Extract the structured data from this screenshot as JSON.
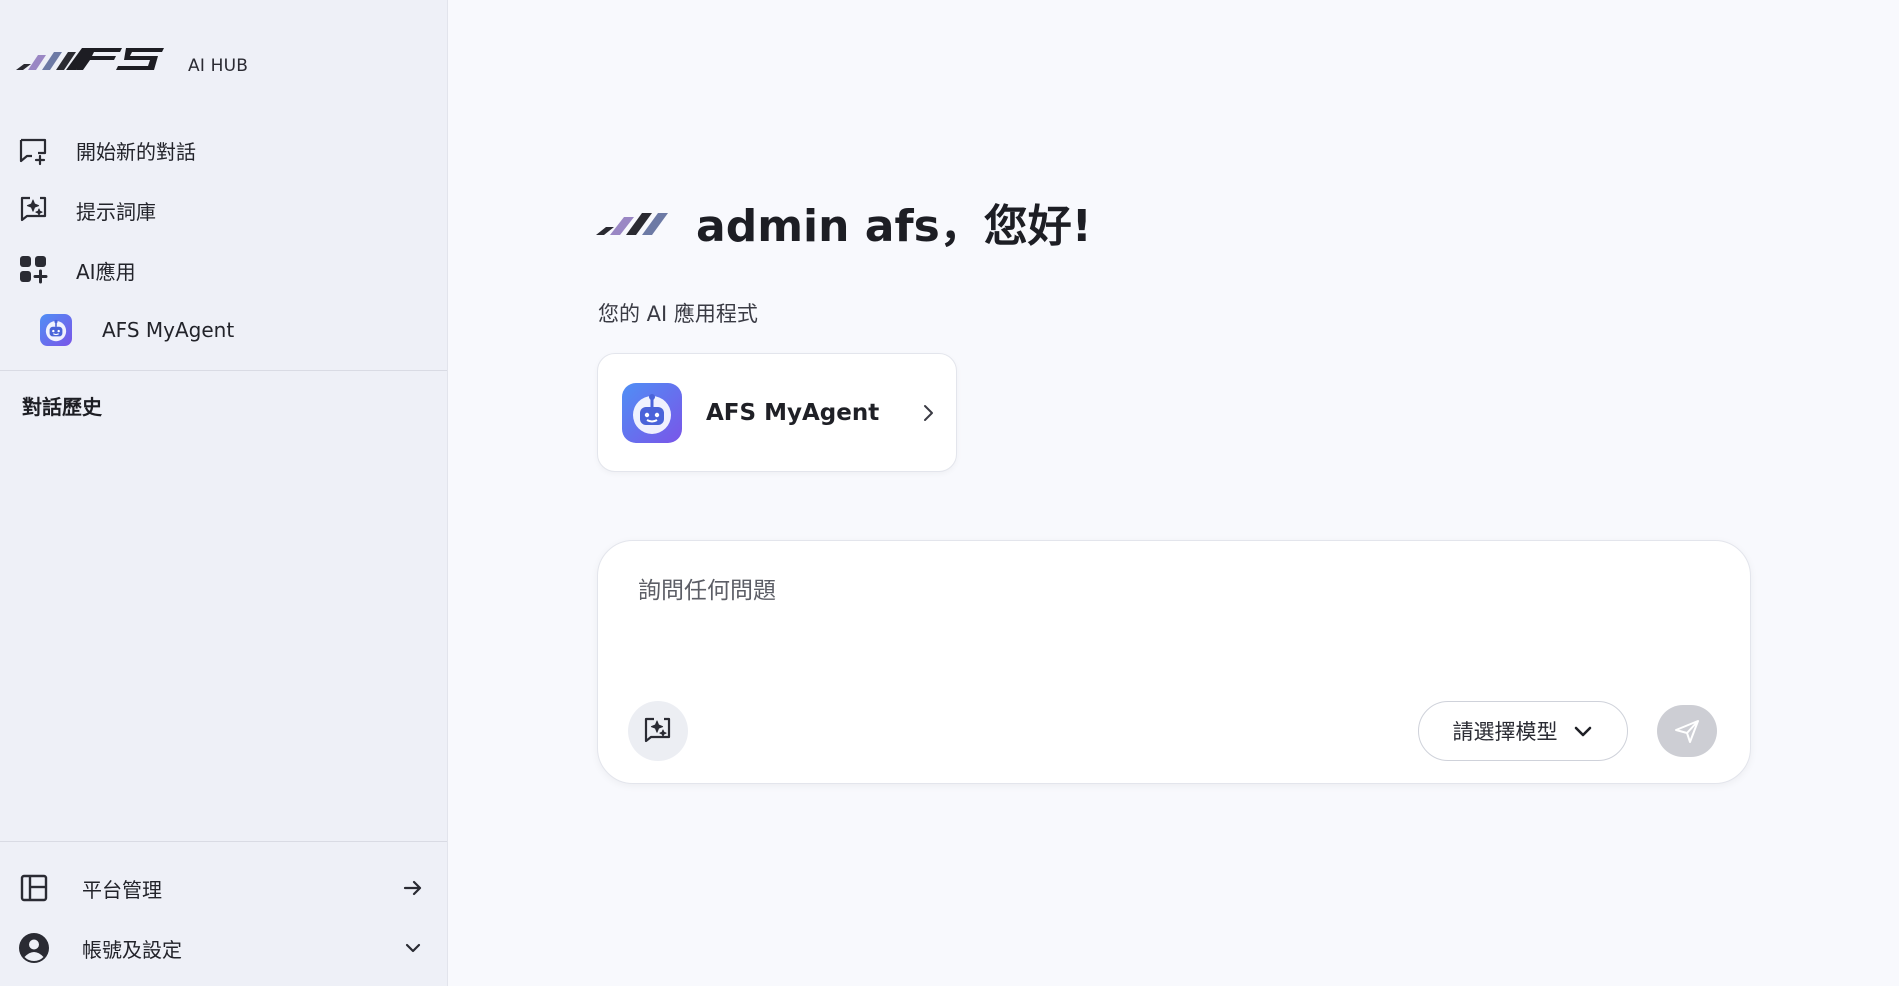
{
  "brand": {
    "logo_text": "AFS",
    "sub": "AI HUB"
  },
  "sidebar": {
    "items": [
      {
        "label": "開始新的對話",
        "icon": "new-chat-icon"
      },
      {
        "label": "提示詞庫",
        "icon": "prompt-library-icon"
      },
      {
        "label": "AI應用",
        "icon": "apps-grid-icon"
      },
      {
        "label": "AFS MyAgent",
        "icon": "robot-icon"
      }
    ],
    "history_title": "對話歷史",
    "bottom": [
      {
        "label": "平台管理",
        "icon": "layout-panel-icon",
        "trail": "arrow-right-icon"
      },
      {
        "label": "帳號及設定",
        "icon": "account-circle-icon",
        "trail": "chevron-down-icon"
      }
    ]
  },
  "main": {
    "greeting": "admin afs，您好!",
    "apps_label": "您的 AI 應用程式",
    "app_card": {
      "name": "AFS MyAgent"
    },
    "composer": {
      "placeholder": "詢問任何問題",
      "model_select_label": "請選擇模型"
    }
  },
  "colors": {
    "sidebar_bg": "#eef0f7",
    "main_bg": "#f8f9fd",
    "send_disabled": "#cdced4",
    "robot_gradient_start": "#4f8ff5",
    "robot_gradient_end": "#7a55e8"
  }
}
